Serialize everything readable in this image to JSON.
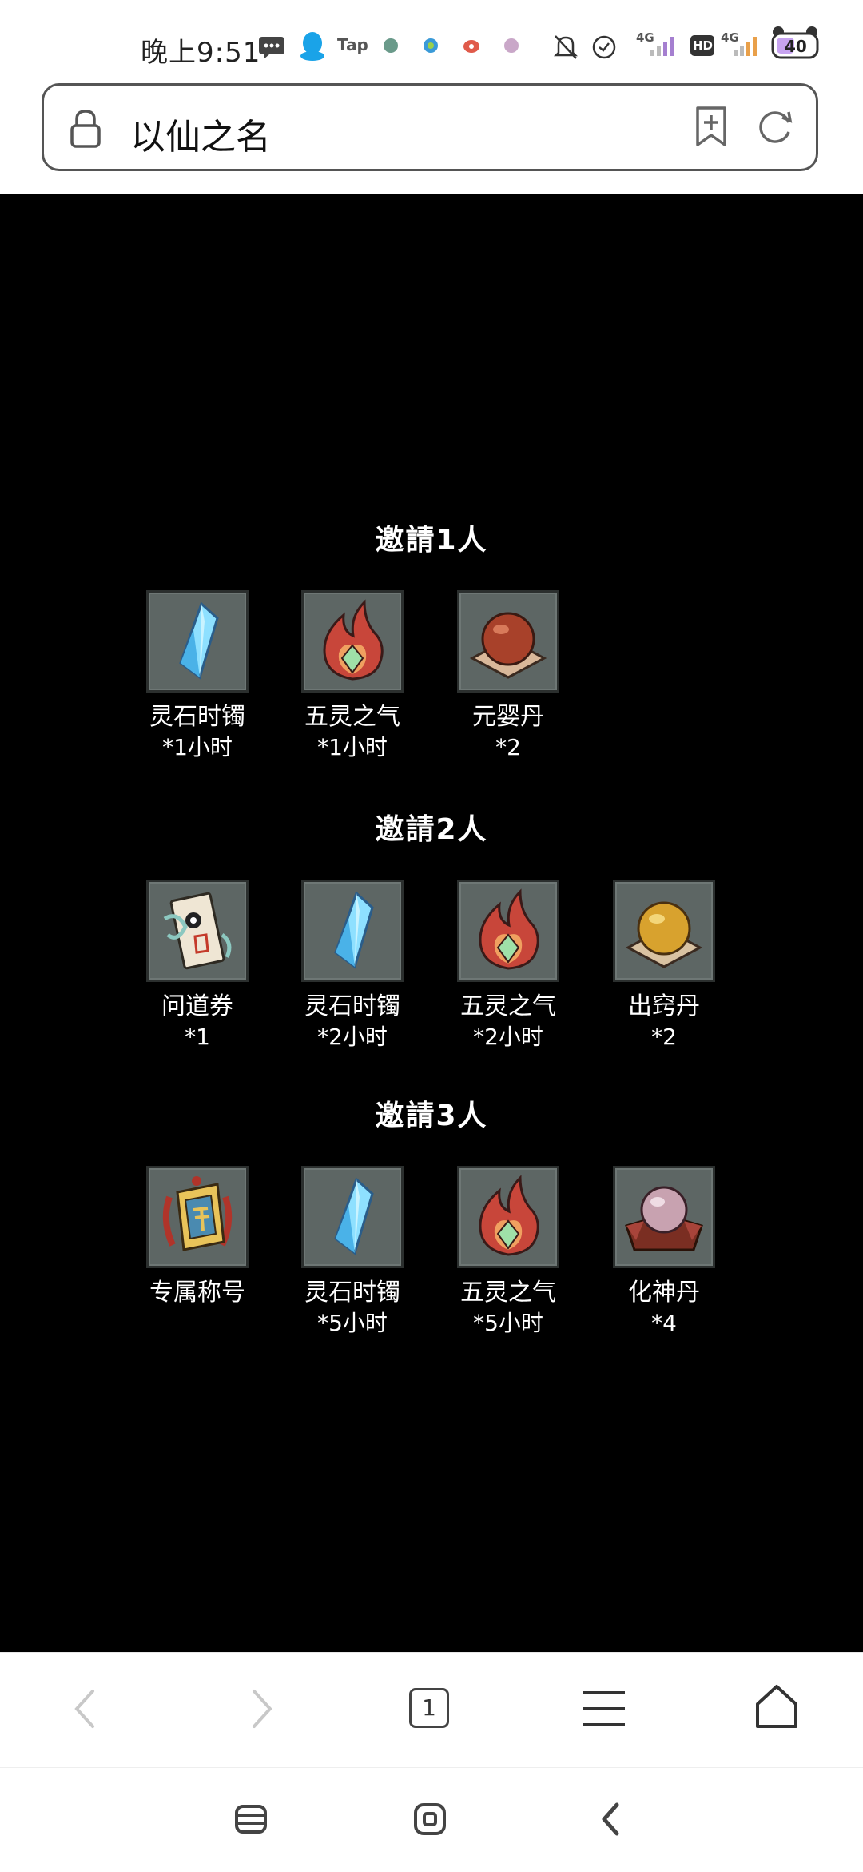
{
  "status_bar": {
    "time": "晚上9:51",
    "tap_label": "Tap",
    "network1": "4G",
    "hd_label": "HD",
    "network2": "4G",
    "battery": "40"
  },
  "address_bar": {
    "page_title": "以仙之名"
  },
  "tiers": [
    {
      "title": "邀請1人",
      "items": [
        {
          "name": "灵石时镯",
          "amount": "*1小时",
          "icon": "crystal-icon"
        },
        {
          "name": "五灵之气",
          "amount": "*1小时",
          "icon": "flame-icon"
        },
        {
          "name": "元婴丹",
          "amount": "*2",
          "icon": "red-pill-icon"
        }
      ]
    },
    {
      "title": "邀請2人",
      "items": [
        {
          "name": "问道券",
          "amount": "*1",
          "icon": "ticket-icon"
        },
        {
          "name": "灵石时镯",
          "amount": "*2小时",
          "icon": "crystal-icon"
        },
        {
          "name": "五灵之气",
          "amount": "*2小时",
          "icon": "flame-icon"
        },
        {
          "name": "出窍丹",
          "amount": "*2",
          "icon": "gold-pill-icon"
        }
      ]
    },
    {
      "title": "邀請3人",
      "items": [
        {
          "name": "专属称号",
          "amount": "",
          "icon": "title-badge-icon"
        },
        {
          "name": "灵石时镯",
          "amount": "*5小时",
          "icon": "crystal-icon"
        },
        {
          "name": "五灵之气",
          "amount": "*5小时",
          "icon": "flame-icon"
        },
        {
          "name": "化神丹",
          "amount": "*4",
          "icon": "purple-orb-icon"
        }
      ]
    }
  ],
  "browser_nav": {
    "tab_count": "1"
  },
  "colors": {
    "content_bg": "#000000",
    "slot_bg": "#5d6664",
    "text": "#ffffff"
  }
}
